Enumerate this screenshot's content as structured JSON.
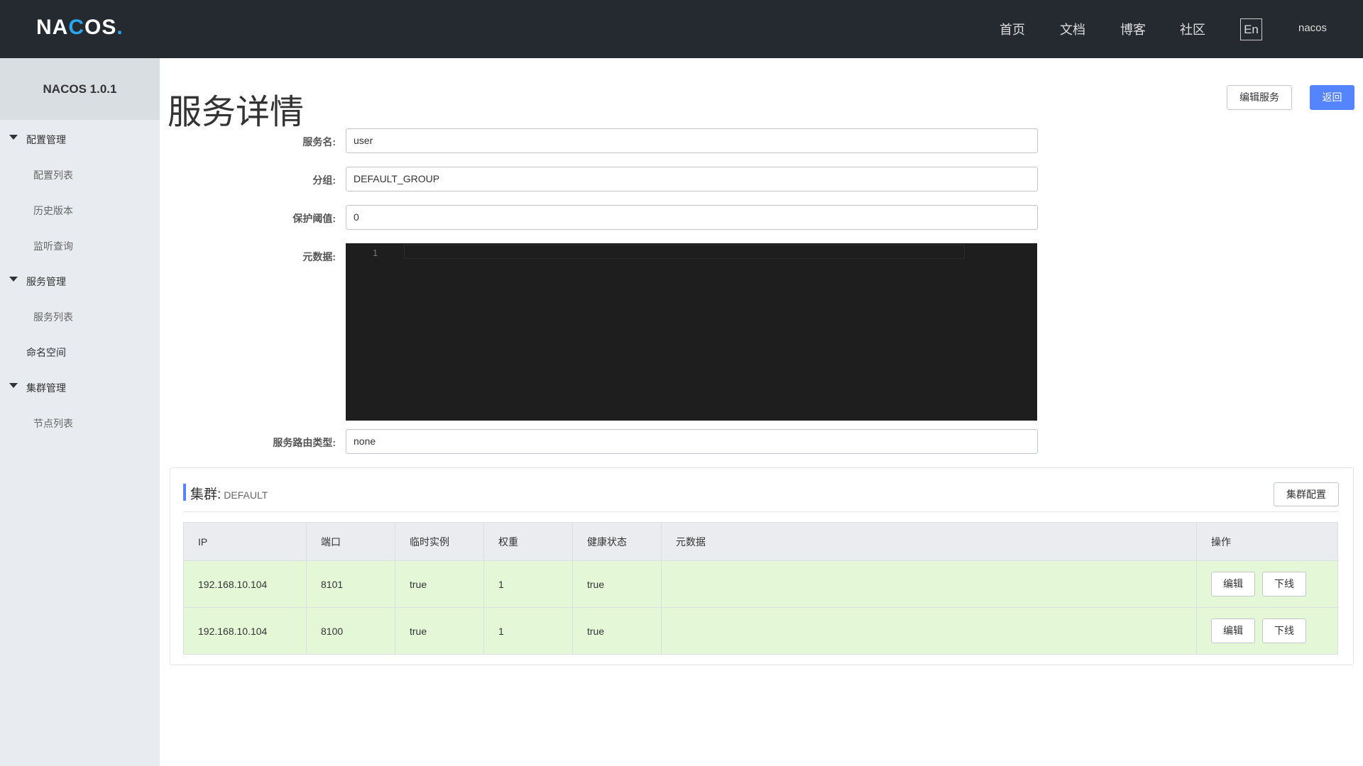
{
  "header": {
    "logo": "NACOS.",
    "nav": [
      "首页",
      "文档",
      "博客",
      "社区"
    ],
    "lang": "En",
    "user": "nacos"
  },
  "sidebar": {
    "version": "NACOS 1.0.1",
    "groups": [
      {
        "label": "配置管理",
        "items": [
          "配置列表",
          "历史版本",
          "监听查询"
        ]
      },
      {
        "label": "服务管理",
        "items": [
          "服务列表"
        ]
      },
      {
        "label": "命名空间"
      },
      {
        "label": "集群管理",
        "items": [
          "节点列表"
        ]
      }
    ]
  },
  "page": {
    "title": "服务详情",
    "edit_button": "编辑服务",
    "back_button": "返回"
  },
  "form": {
    "service_name_label": "服务名:",
    "service_name": "user",
    "group_label": "分组:",
    "group": "DEFAULT_GROUP",
    "threshold_label": "保护阈值:",
    "threshold": "0",
    "metadata_label": "元数据:",
    "metadata_line": "1",
    "route_label": "服务路由类型:",
    "route": "none"
  },
  "cluster": {
    "title": "集群:",
    "name": "DEFAULT",
    "config_button": "集群配置",
    "columns": [
      "IP",
      "端口",
      "临时实例",
      "权重",
      "健康状态",
      "元数据",
      "操作"
    ],
    "rows": [
      {
        "ip": "192.168.10.104",
        "port": "8101",
        "ephemeral": "true",
        "weight": "1",
        "healthy": "true",
        "metadata": ""
      },
      {
        "ip": "192.168.10.104",
        "port": "8100",
        "ephemeral": "true",
        "weight": "1",
        "healthy": "true",
        "metadata": ""
      }
    ],
    "edit_label": "编辑",
    "offline_label": "下线"
  },
  "colors": {
    "header_bg": "#252a31",
    "primary": "#5584ff",
    "row_bg": "#e4f8d8"
  }
}
